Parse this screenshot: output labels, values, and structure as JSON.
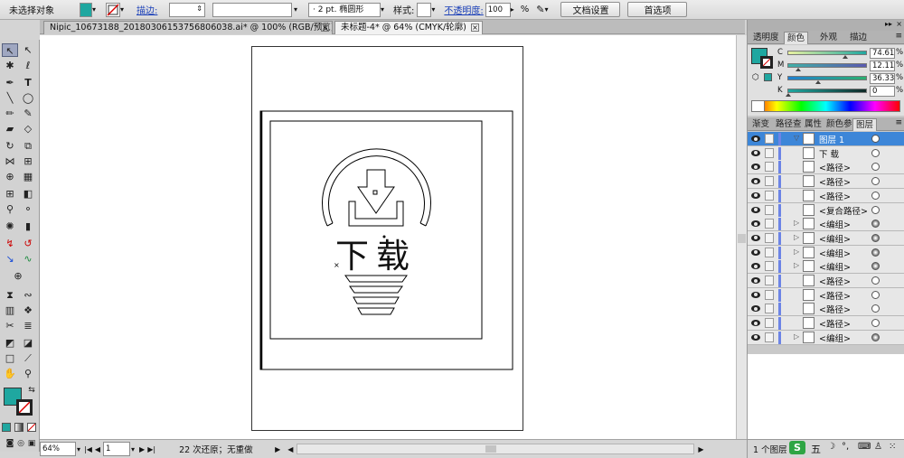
{
  "control": {
    "selection": "未选择对象",
    "stroke_label": "描边:",
    "stroke_size": "2 pt.",
    "brush": "椭圆形",
    "style_label": "样式:",
    "opacity_label": "不透明度:",
    "opacity_value": "100",
    "percent": "%",
    "doc_setup": "文档设置",
    "prefs": "首选项"
  },
  "tabs": [
    {
      "label": "Nipic_10673188_20180306153756806038.ai* @ 100% (RGB/预览)",
      "active": false
    },
    {
      "label": "未标题-4* @ 64% (CMYK/轮廓)",
      "active": true
    }
  ],
  "artboard_text": "下载",
  "status": {
    "zoom": "64%",
    "page": "1",
    "undo": "22 次还原；无重做"
  },
  "color_panel": {
    "tabs": [
      "透明度",
      "颜色",
      "外观",
      "描边"
    ],
    "active_tab": "颜色",
    "channels": [
      {
        "label": "C",
        "value": "74.61"
      },
      {
        "label": "M",
        "value": "12.11"
      },
      {
        "label": "Y",
        "value": "36.33"
      },
      {
        "label": "K",
        "value": "0"
      }
    ],
    "percent": "%",
    "fill_color": "#1fa7a0"
  },
  "layers_panel": {
    "tabs": [
      "渐变",
      "路径查",
      "属性",
      "颜色参",
      "图层"
    ],
    "active_tab": "图层",
    "layers": [
      {
        "name": "图层 1",
        "expander": "▽",
        "top": true,
        "target_filled": false
      },
      {
        "name": "下 载",
        "expander": "",
        "top": false,
        "target_filled": false
      },
      {
        "name": "<路径>",
        "expander": "",
        "top": false,
        "target_filled": false
      },
      {
        "name": "<路径>",
        "expander": "",
        "top": false,
        "target_filled": false
      },
      {
        "name": "<路径>",
        "expander": "",
        "top": false,
        "target_filled": false
      },
      {
        "name": "<复合路径>",
        "expander": "",
        "top": false,
        "target_filled": false
      },
      {
        "name": "<编组>",
        "expander": "▷",
        "top": false,
        "target_filled": true
      },
      {
        "name": "<编组>",
        "expander": "▷",
        "top": false,
        "target_filled": true
      },
      {
        "name": "<编组>",
        "expander": "▷",
        "top": false,
        "target_filled": true
      },
      {
        "name": "<编组>",
        "expander": "▷",
        "top": false,
        "target_filled": true
      },
      {
        "name": "<路径>",
        "expander": "",
        "top": false,
        "target_filled": false
      },
      {
        "name": "<路径>",
        "expander": "",
        "top": false,
        "target_filled": false
      },
      {
        "name": "<路径>",
        "expander": "",
        "top": false,
        "target_filled": false
      },
      {
        "name": "<路径>",
        "expander": "",
        "top": false,
        "target_filled": false
      },
      {
        "name": "<编组>",
        "expander": "▷",
        "top": false,
        "target_filled": true
      }
    ],
    "footer": "1 个图层"
  },
  "taskbar": {
    "ime": "五"
  }
}
